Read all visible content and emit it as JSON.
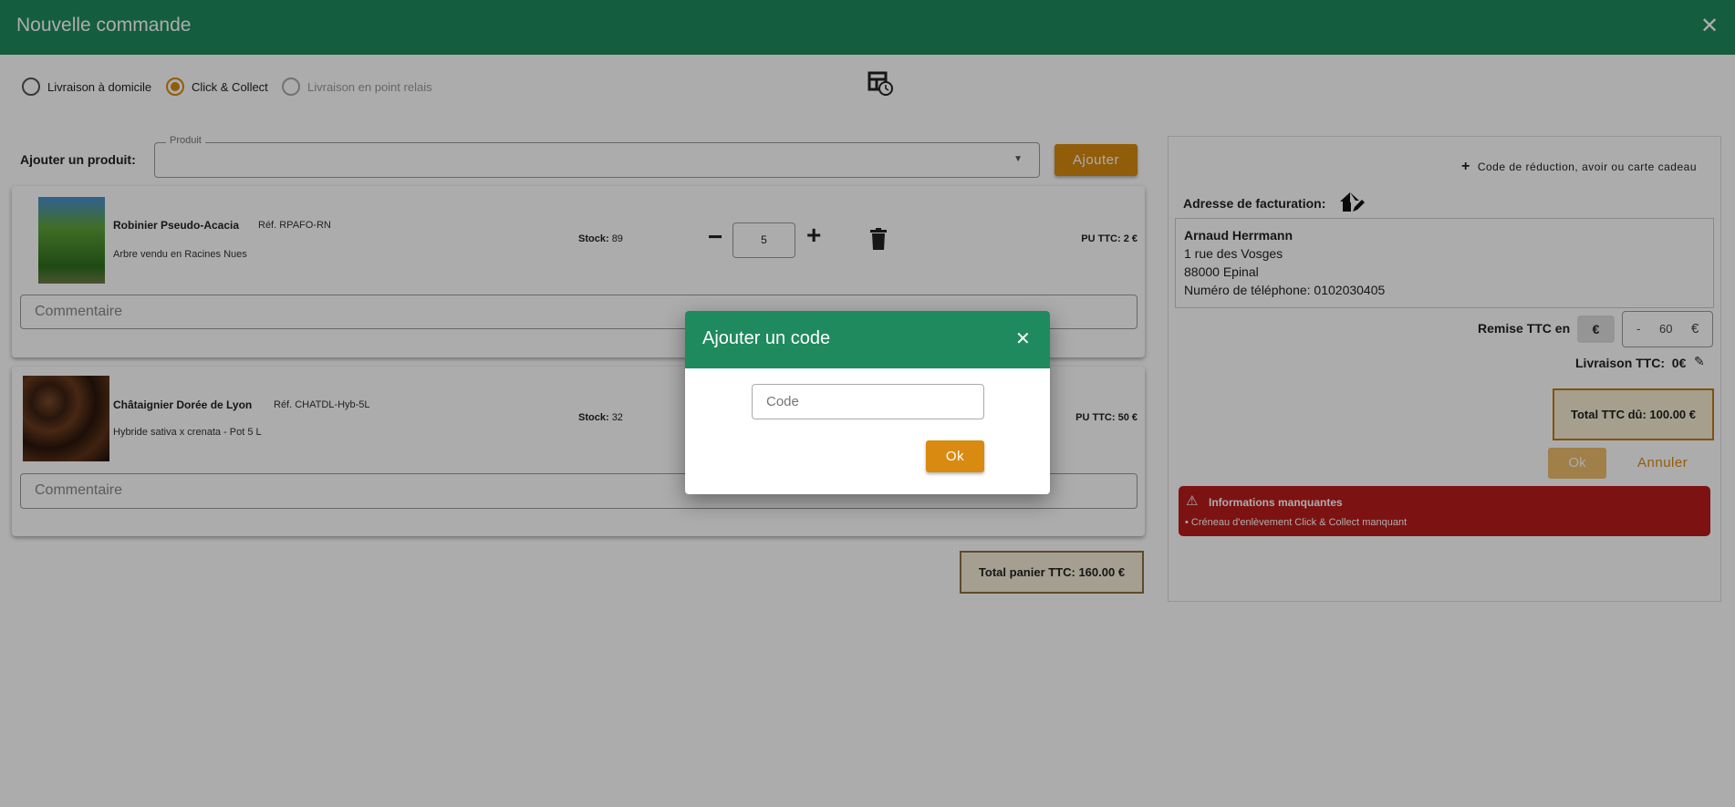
{
  "header": {
    "title": "Nouvelle commande",
    "close": "✕"
  },
  "delivery": {
    "options": [
      {
        "label": "Livraison à domicile"
      },
      {
        "label": "Click & Collect"
      },
      {
        "label": "Livraison en point relais"
      }
    ]
  },
  "add_product": {
    "label": "Ajouter un produit:",
    "field_label": "Produit",
    "button": "Ajouter"
  },
  "products": [
    {
      "name": "Robinier Pseudo-Acacia",
      "ref": "Réf. RPAFO-RN",
      "desc": "Arbre vendu en Racines Nues",
      "stock_label": "Stock:",
      "stock": "89",
      "qty": "5",
      "price": "PU TTC: 2 €",
      "comment_placeholder": "Commentaire"
    },
    {
      "name": "Châtaignier Dorée de Lyon",
      "ref": "Réf. CHATDL-Hyb-5L",
      "desc": "Hybride sativa x crenata - Pot 5 L",
      "stock_label": "Stock:",
      "stock": "32",
      "qty": "",
      "price": "PU TTC: 50 €",
      "comment_placeholder": "Commentaire"
    }
  ],
  "cart_total": "Total panier TTC: 160.00 €",
  "right": {
    "code_link": "Code de réduction, avoir ou carte cadeau",
    "billing_label": "Adresse de facturation:",
    "address": {
      "name": "Arnaud Herrmann",
      "line1": "1 rue des Vosges",
      "line2": "88000 Epinal",
      "phone": "Numéro de téléphone: 0102030405"
    },
    "discount_label": "Remise TTC en",
    "discount_unit": "€",
    "discount_sign": "-",
    "discount_value": "60",
    "discount_suffix": "€",
    "shipping": "Livraison TTC:  0€",
    "total_due": "Total TTC dû: 100.00 €",
    "ok": "Ok",
    "cancel": "Annuler",
    "alert": {
      "title": "Informations manquantes",
      "item": "• Créneau d'enlèvement Click & Collect manquant"
    }
  },
  "modal": {
    "title": "Ajouter un code",
    "close": "✕",
    "placeholder": "Code",
    "ok": "Ok"
  },
  "colors": {
    "primary": "#1f8a5e",
    "accent": "#d98a10",
    "danger": "#b81c1c"
  }
}
